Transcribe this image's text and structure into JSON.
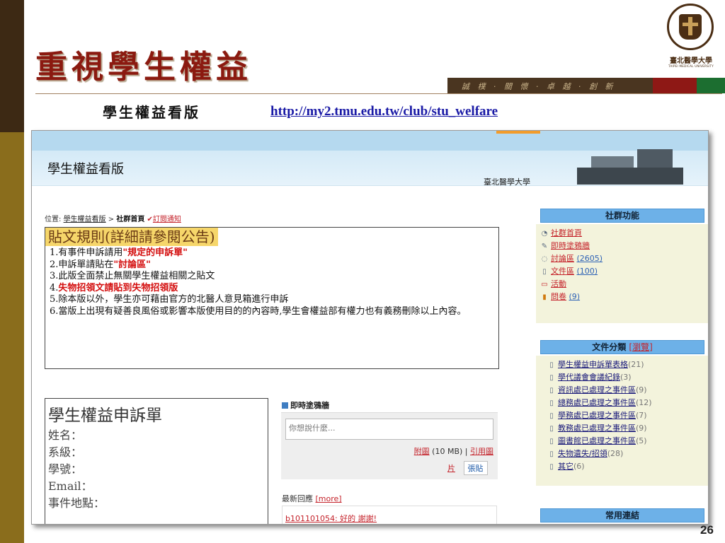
{
  "slide": {
    "title": "重視學生權益",
    "subtitle": "學生權益看版",
    "url": "http://my2.tmu.edu.tw/club/stu_welfare",
    "motto": "誠 樸 · 關 懷 · 卓 越 · 創 新",
    "page_number": "26",
    "logo": {
      "icon": "tmu-seal-icon",
      "ring_text": "TAIPEI MEDICAL UNIVERSITY",
      "year": "1960",
      "name": "臺北醫學大學",
      "sub": "TAIPEI MEDICAL UNIVERSITY"
    },
    "colors": {
      "title": "#8b1a10",
      "bar_dark": "#3d2914",
      "bar_gold": "#8a6d1c",
      "link": "#1a1aa6"
    }
  },
  "screenshot": {
    "banner_title": "學生權益看版",
    "banner_school": "臺北醫學大學",
    "breadcrumb": {
      "prefix": "位置:",
      "board": "學生權益看版",
      "sep": ">",
      "current": "社群首頁",
      "check": "✔",
      "subscribe": "訂閱通知"
    },
    "rules": {
      "title": "貼文規則(詳細請參閱公告)",
      "items": [
        {
          "pre": "1.有事件申訴請用",
          "red": "\"規定的申訴單\"",
          "post": ""
        },
        {
          "pre": "2.申訴單請貼在",
          "red": "\"討論區\"",
          "post": ""
        },
        {
          "pre": "3.此版全面禁止無關學生權益相關之貼文",
          "red": "",
          "post": ""
        },
        {
          "pre": "4.",
          "red": "失物招領文請貼到失物招領版",
          "post": ""
        },
        {
          "pre": "5.除本版以外，學生亦可藉由官方的北醫人意見箱進行申訴",
          "red": "",
          "post": ""
        },
        {
          "pre": "6.當版上出現有疑善良風俗或影響本版使用目的的內容時,學生會權益部有權力也有義務刪除以上內容。",
          "red": "",
          "post": ""
        }
      ]
    },
    "form": {
      "title": "學生權益申訴單",
      "fields": [
        "姓名：",
        "系級：",
        "學號：",
        "Email：",
        "事件地點："
      ]
    },
    "doodle": {
      "header": "即時塗鴉牆",
      "placeholder": "你想說什麼...",
      "attach_label": "附圖",
      "attach_size": "(10 MB) |",
      "cite_label_1": "引用圖",
      "cite_label_2": "片",
      "paste_button": "張貼",
      "replies_label": "最新回應",
      "more_label": "[more]",
      "latest_reply": "b101101054: 好的 謝謝!"
    },
    "sidebar": {
      "features_title": "社群功能",
      "features": [
        {
          "icon": "tag-icon",
          "label": "社群首頁",
          "count": ""
        },
        {
          "icon": "pencil-icon",
          "label": "即時塗鴉牆",
          "count": ""
        },
        {
          "icon": "speech-bubble-icon",
          "label": "討論區",
          "count": "(2605)"
        },
        {
          "icon": "document-icon",
          "label": "文件區",
          "count": "(100)"
        },
        {
          "icon": "calendar-icon",
          "label": "活動",
          "count": ""
        },
        {
          "icon": "bar-chart-icon",
          "label": "問卷",
          "count": "(9)"
        }
      ],
      "docs_title": "文件分類",
      "docs_browse": "[瀏覽]",
      "docs": [
        {
          "label": "學生權益申訴單表格",
          "count": "(21)"
        },
        {
          "label": "學代議會會議紀錄",
          "count": "(3)"
        },
        {
          "label": "資訊處已處理之事件區",
          "count": "(9)"
        },
        {
          "label": "總務處已處理之事件區",
          "count": "(12)"
        },
        {
          "label": "學務處已處理之事件區",
          "count": "(7)"
        },
        {
          "label": "教務處已處理之事件區",
          "count": "(9)"
        },
        {
          "label": "圖書館已處理之事件區",
          "count": "(5)"
        },
        {
          "label": "失物遺失/招領",
          "count": "(28)"
        },
        {
          "label": "其它",
          "count": "(6)"
        }
      ],
      "links_title": "常用連結"
    }
  }
}
